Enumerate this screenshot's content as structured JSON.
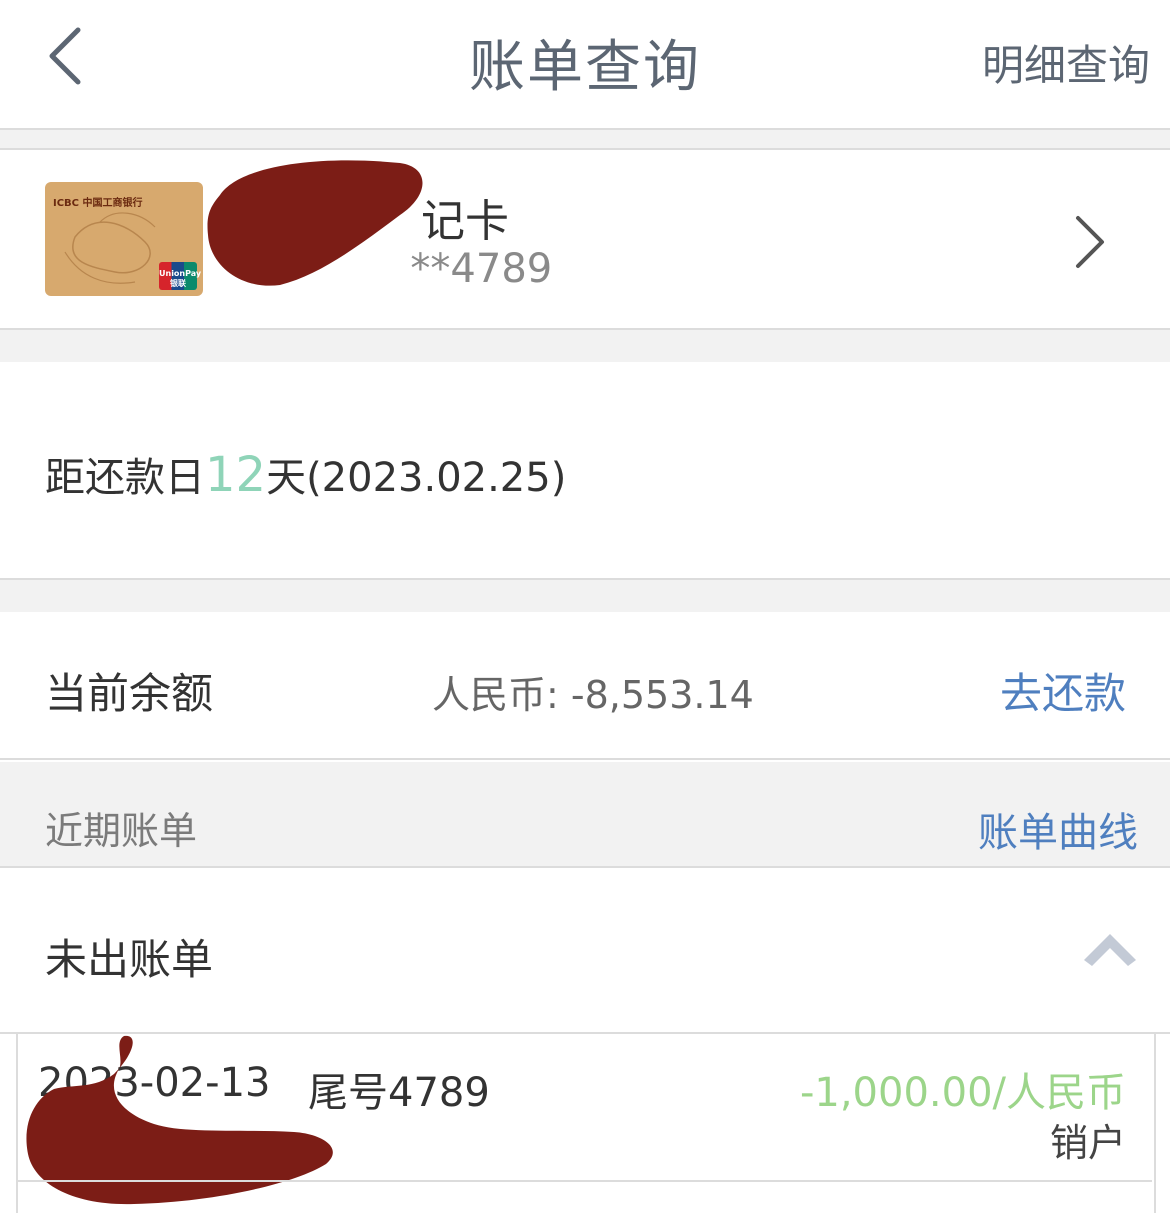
{
  "nav": {
    "title": "账单查询",
    "detail_link": "明细查询"
  },
  "card": {
    "bank_logo_text": "ICBC 中国工商银行",
    "unionpay_text": "UnionPay 银联",
    "name_suffix": "记卡",
    "number_suffix": "**4789"
  },
  "due": {
    "prefix": "距还款日",
    "days": "12",
    "suffix": "天(2023.02.25)"
  },
  "balance": {
    "label": "当前余额",
    "value": "人民币: -8,553.14",
    "repay_link": "去还款"
  },
  "recent": {
    "label": "近期账单",
    "chart_link": "账单曲线"
  },
  "unbilled": {
    "label": "未出账单"
  },
  "transactions": [
    {
      "date": "2023-02-13",
      "tail": "尾号4789",
      "amount": "-1,000.00/人民币",
      "status": "销户"
    }
  ],
  "colors": {
    "accent_link": "#4f7fbf",
    "due_days": "#8fd4b8",
    "amount_green": "#9cd58a",
    "redaction": "#7c1d16"
  }
}
